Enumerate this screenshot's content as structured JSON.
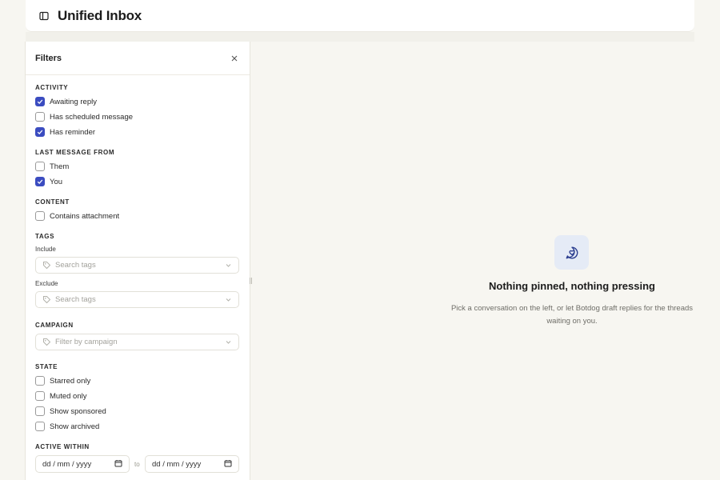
{
  "header": {
    "title": "Unified Inbox",
    "toggle_icon": "sidebar-toggle-icon"
  },
  "filters": {
    "title": "Filters",
    "activity": {
      "title": "ACTIVITY",
      "items": [
        {
          "label": "Awaiting reply",
          "checked": true
        },
        {
          "label": "Has scheduled message",
          "checked": false
        },
        {
          "label": "Has reminder",
          "checked": true
        }
      ]
    },
    "last_message_from": {
      "title": "LAST MESSAGE FROM",
      "items": [
        {
          "label": "Them",
          "checked": false
        },
        {
          "label": "You",
          "checked": true
        }
      ]
    },
    "content": {
      "title": "CONTENT",
      "items": [
        {
          "label": "Contains attachment",
          "checked": false
        }
      ]
    },
    "tags": {
      "title": "TAGS",
      "include_label": "Include",
      "include_placeholder": "Search tags",
      "exclude_label": "Exclude",
      "exclude_placeholder": "Search tags"
    },
    "campaign": {
      "title": "CAMPAIGN",
      "placeholder": "Filter by campaign"
    },
    "state": {
      "title": "STATE",
      "items": [
        {
          "label": "Starred only",
          "checked": false
        },
        {
          "label": "Muted only",
          "checked": false
        },
        {
          "label": "Show sponsored",
          "checked": false
        },
        {
          "label": "Show archived",
          "checked": false
        }
      ]
    },
    "active_within": {
      "title": "ACTIVE WITHIN",
      "from_placeholder": "dd / mm / yyyy",
      "to_label": "to",
      "to_placeholder": "dd / mm / yyyy"
    }
  },
  "empty_state": {
    "title": "Nothing pinned, nothing pressing",
    "body": "Pick a conversation on the left, or let Botdog draft replies for the threads waiting on you.",
    "icon": "chat-heart-icon"
  },
  "colors": {
    "accent": "#3b4cc0",
    "background": "#f7f6f1",
    "icon_bg": "#e5ebf6",
    "icon_fg": "#2c3e8f"
  }
}
